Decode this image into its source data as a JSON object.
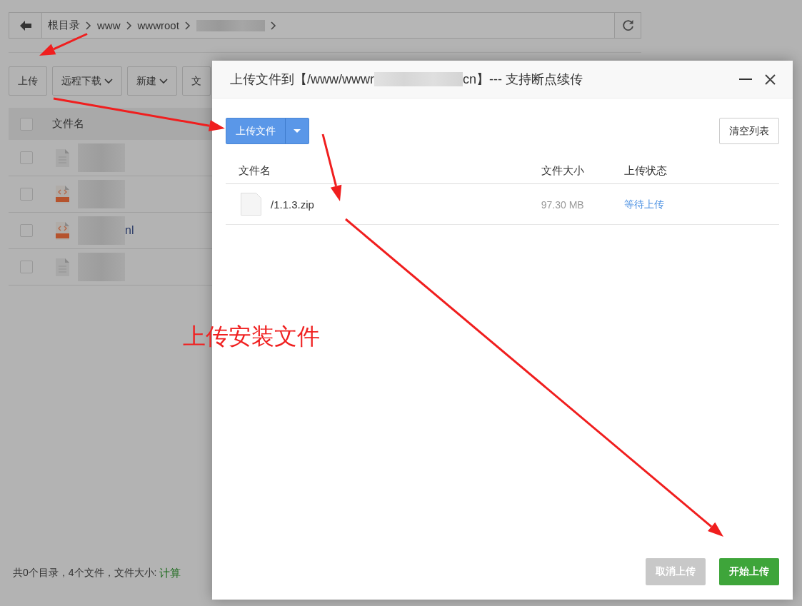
{
  "breadcrumb": {
    "items": [
      {
        "kind": "folder",
        "label": "根目录"
      },
      {
        "kind": "folder",
        "label": "www"
      },
      {
        "kind": "folder",
        "label": "wwwroot"
      },
      {
        "kind": "redacted"
      }
    ]
  },
  "toolbar": [
    {
      "label": "上传",
      "dropdown": false
    },
    {
      "label": "远程下载",
      "dropdown": true
    },
    {
      "label": "新建",
      "dropdown": true
    },
    {
      "label": "文",
      "dropdown": false
    }
  ],
  "file_table": {
    "select_all": {
      "checked": false
    },
    "header": "文件名",
    "rows": [
      {
        "kind": "doc",
        "checked": false,
        "redacted": true
      },
      {
        "kind": "html",
        "checked": false,
        "redacted": true
      },
      {
        "kind": "html",
        "checked": false,
        "redacted": true,
        "name": "nl"
      },
      {
        "kind": "doc",
        "checked": false,
        "redacted": true
      }
    ]
  },
  "footer": {
    "text": "共0个目录，4个文件，文件大小:",
    "link": "计算"
  },
  "dialog": {
    "title_start": "上传文件到【/www/wwwr",
    "title_end": "cn】--- 支持断点续传",
    "upload_button": "上传文件",
    "clear_button": "清空列表",
    "columns": [
      "文件名",
      "文件大小",
      "上传状态"
    ],
    "rows": [
      {
        "name": "/1.1.3.zip",
        "size": "97.30 MB",
        "status": "等待上传"
      }
    ],
    "cancel_button": {
      "label": "取消上传",
      "disabled": true
    },
    "start_button": {
      "label": "开始上传",
      "disabled": false
    }
  },
  "annotation": {
    "text": "上传安装文件"
  }
}
